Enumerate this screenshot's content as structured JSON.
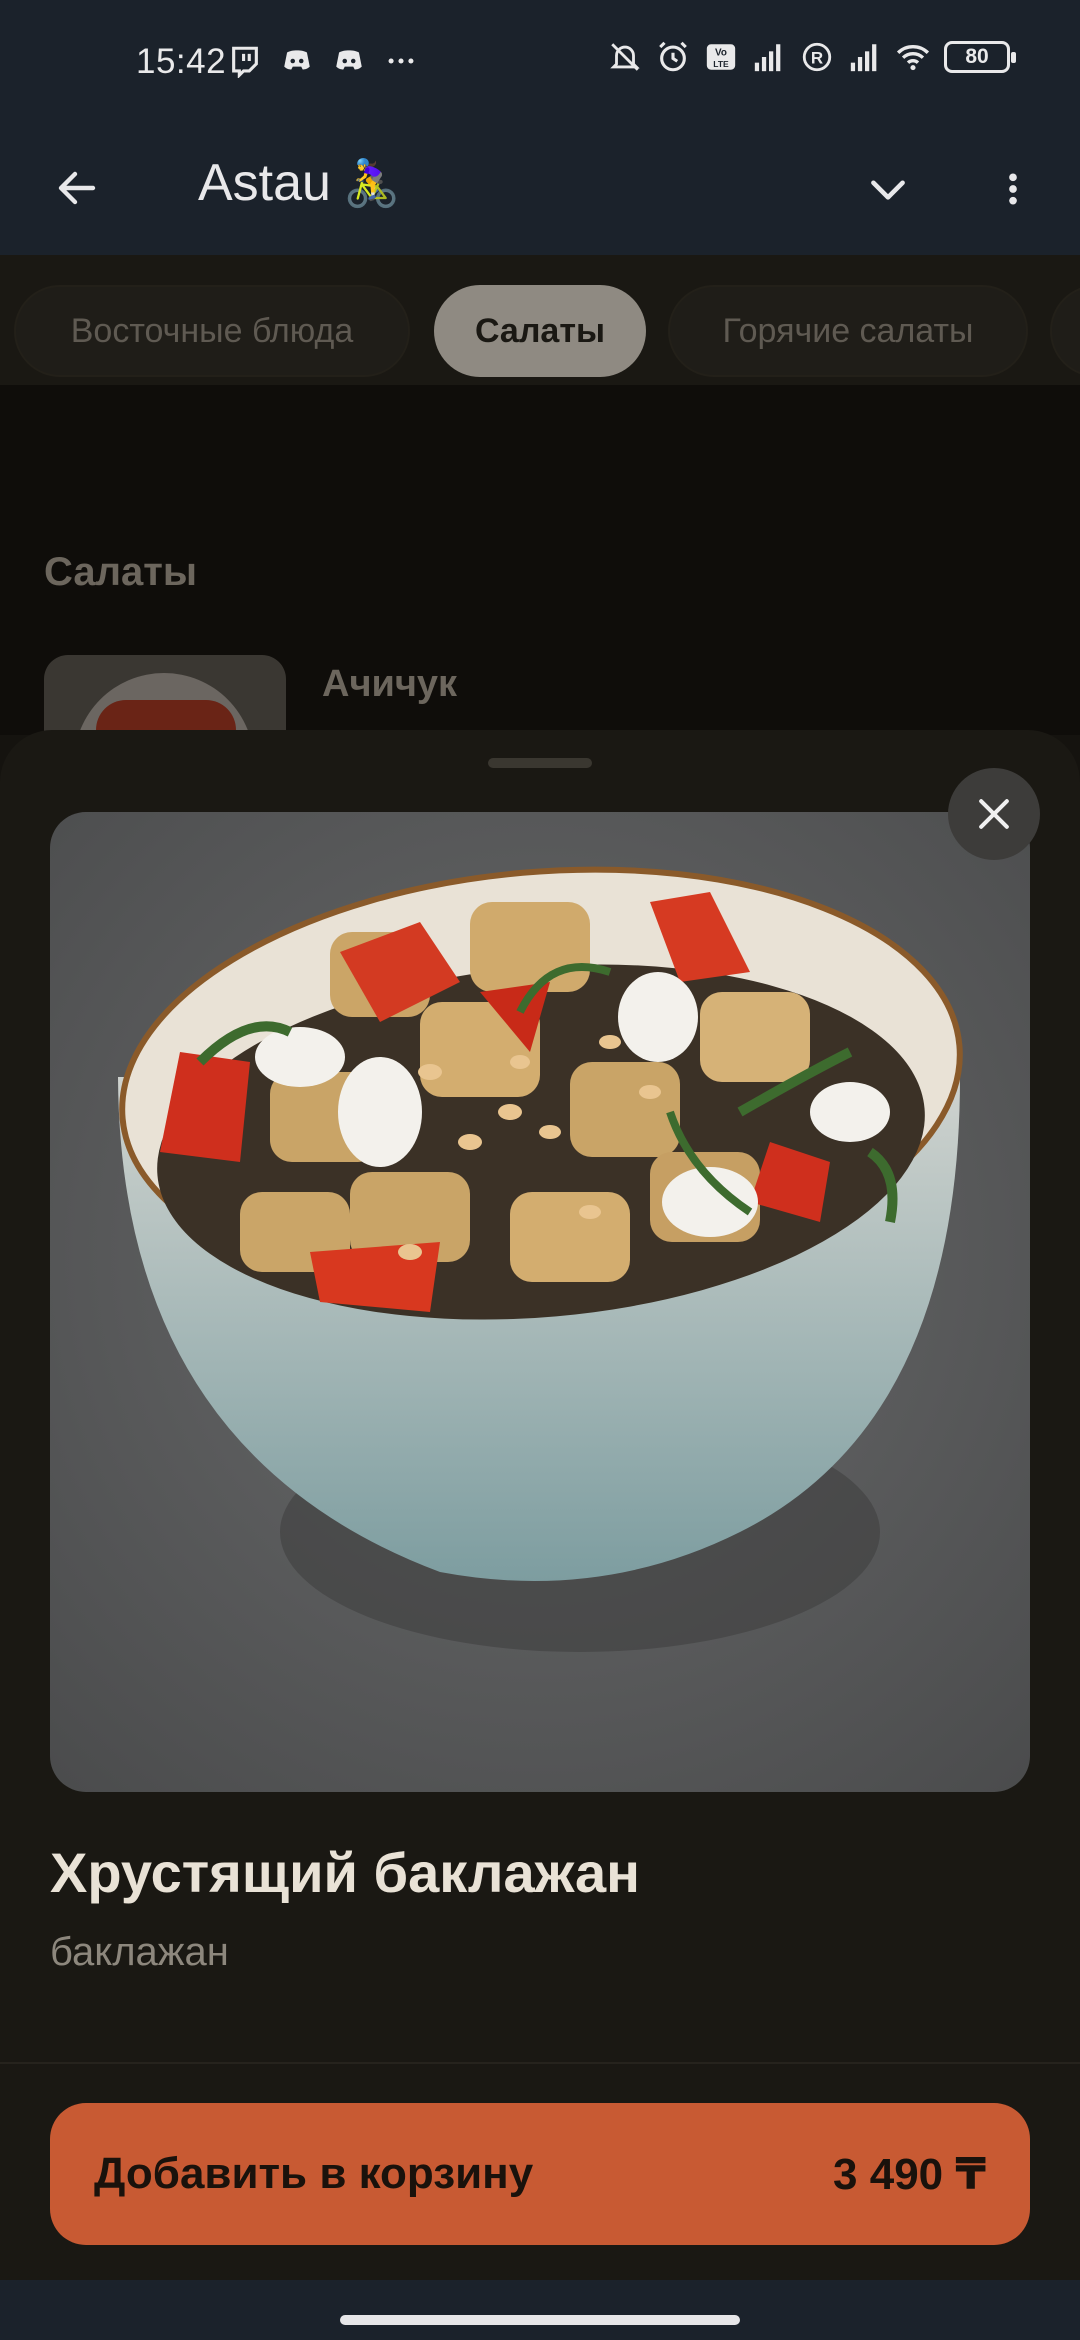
{
  "status_bar": {
    "time": "15:42",
    "battery": "80",
    "left_icons": [
      "twitch-icon",
      "discord-icon",
      "discord-icon",
      "more-dots-icon"
    ],
    "right_icons": [
      "mute-icon",
      "alarm-icon",
      "volte-icon",
      "signal-icon",
      "roaming-icon",
      "signal-icon",
      "wifi-icon"
    ]
  },
  "app_bar": {
    "title": "Astau",
    "title_emoji": "🚴‍♀️"
  },
  "categories": [
    {
      "label": "Восточные блюда",
      "active": false
    },
    {
      "label": "Салаты",
      "active": true
    },
    {
      "label": "Горячие салаты",
      "active": false
    }
  ],
  "list": {
    "section_title": "Салаты",
    "item_name": "Ачичук"
  },
  "sheet": {
    "dish_title": "Хрустящий баклажан",
    "dish_description": "баклажан",
    "add_to_cart_label": "Добавить в корзину",
    "price": "3 490 ₸"
  },
  "colors": {
    "accent": "#c85a33",
    "app_bar_bg": "#1b222b",
    "sheet_bg": "#1a1813"
  }
}
